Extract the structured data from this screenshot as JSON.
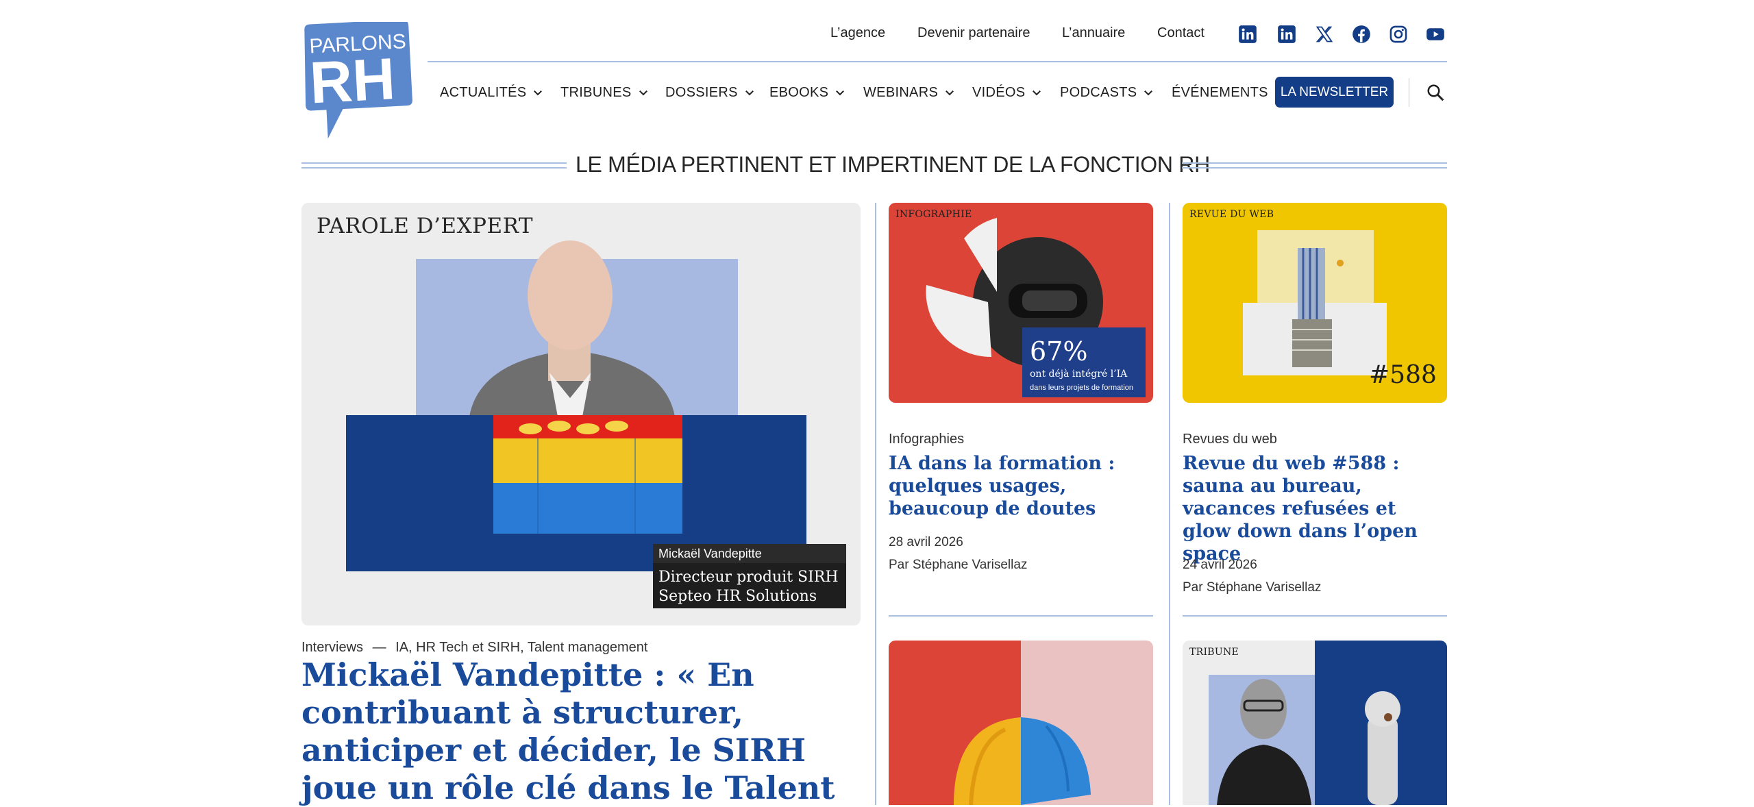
{
  "header": {
    "logo": {
      "line1": "PARLONS",
      "line2": "RH"
    },
    "top_links": [
      "L’agence",
      "Devenir partenaire",
      "L’annuaire",
      "Contact"
    ],
    "social": [
      "linkedin-icon",
      "linkedin-icon",
      "x-icon",
      "facebook-icon",
      "instagram-icon",
      "youtube-icon"
    ],
    "nav": [
      "ACTUALITÉS",
      "TRIBUNES",
      "DOSSIERS",
      "EBOOKS",
      "WEBINARS",
      "VIDÉOS",
      "PODCASTS",
      "ÉVÉNEMENTS"
    ],
    "newsletter": "LA NEWSLETTER"
  },
  "tagline": "LE MÉDIA PERTINENT ET IMPERTINENT DE LA FONCTION RH",
  "featured": {
    "kicker": "PAROLE D’EXPERT",
    "person_name": "Mickaël Vandepitte",
    "person_role_1": "Directeur produit SIRH",
    "person_role_2": "Septeo HR Solutions",
    "category": "Interviews",
    "dash": "—",
    "tags": "IA, HR Tech et SIRH, Talent management",
    "title": "Mickaël Vandepitte : « En contribuant à structurer, anticiper et décider, le SIRH joue un rôle clé dans le Talent"
  },
  "cards": [
    {
      "kicker": "INFOGRAPHIE",
      "stat": "67%",
      "stat_line1": "ont déjà intégré l’IA",
      "stat_line2": "dans leurs projets de formation",
      "category": "Infographies",
      "title": "IA dans la formation : quelques usages, beaucoup de doutes",
      "date": "28 avril 2026",
      "author": "Par Stéphane Varisellaz"
    },
    {
      "kicker": "REVUE DU WEB",
      "number": "#588",
      "category": "Revues du web",
      "title": "Revue du web #588 : sauna au bureau, vacances refusées et glow down dans l’open space",
      "date": "24 avril 2026",
      "author": "Par Stéphane Varisellaz"
    },
    {
      "kicker": ""
    },
    {
      "kicker": "TRIBUNE"
    }
  ],
  "colors": {
    "brand_blue": "#133d86",
    "title_blue": "#1a4a9a",
    "rule": "#a9bfe1",
    "red": "#dc4438",
    "yellow": "#f0c600"
  }
}
